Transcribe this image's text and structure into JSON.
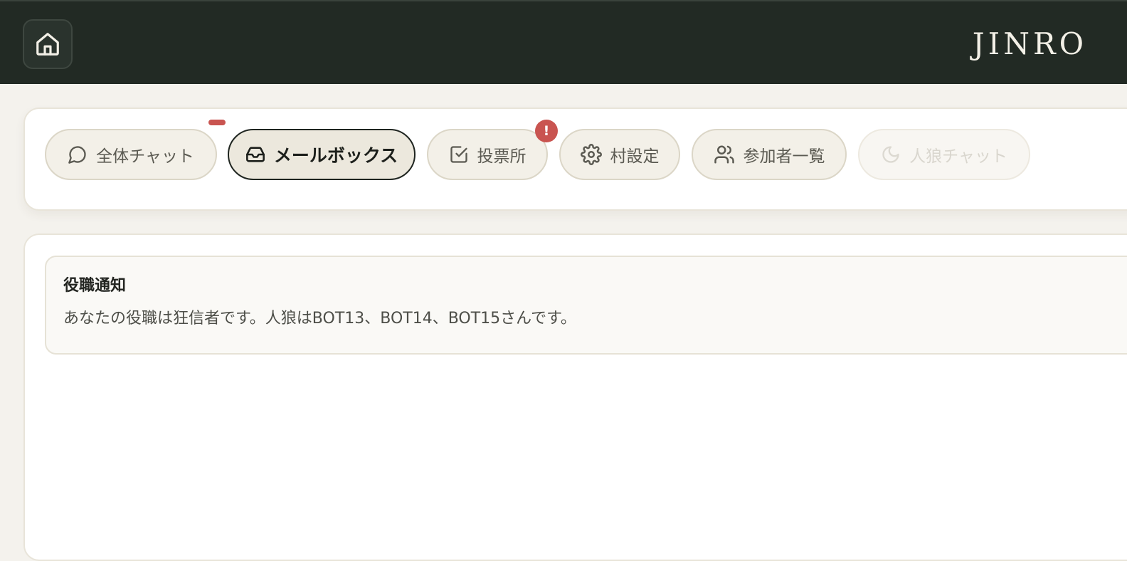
{
  "header": {
    "brand": "JINRO",
    "home_icon": "home-icon"
  },
  "tabs": [
    {
      "label": "全体チャット",
      "icon": "chat-bubble-icon",
      "state": "normal"
    },
    {
      "label": "メールボックス",
      "icon": "inbox-icon",
      "state": "active"
    },
    {
      "label": "投票所",
      "icon": "checkbox-icon",
      "state": "normal"
    },
    {
      "label": "村設定",
      "icon": "gear-icon",
      "state": "normal"
    },
    {
      "label": "参加者一覧",
      "icon": "users-icon",
      "state": "normal"
    },
    {
      "label": "人狼チャット",
      "icon": "moon-icon",
      "state": "disabled"
    }
  ],
  "badges": {
    "vote_alert": "!"
  },
  "colors": {
    "header_bg": "#222a24",
    "page_bg": "#f4f2ed",
    "badge": "#c95450",
    "active_tab_border": "#1f2520"
  },
  "mailbox": {
    "messages": [
      {
        "title": "役職通知",
        "body": "あなたの役職は狂信者です。人狼はBOT13、BOT14、BOT15さんです。"
      }
    ]
  }
}
